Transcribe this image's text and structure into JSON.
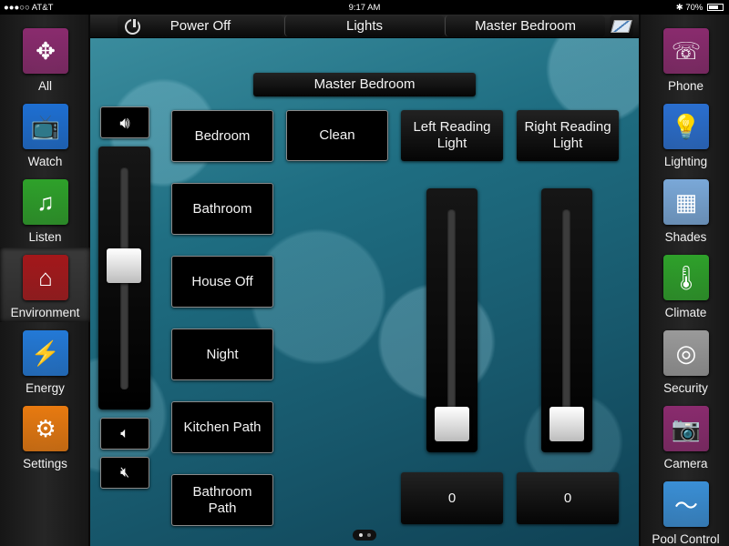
{
  "status_bar": {
    "carrier": "●●●○○ AT&T",
    "time": "9:17 AM",
    "battery": "70%",
    "battery_level": 0.7
  },
  "left_nav": [
    {
      "label": "All",
      "icon": "compass-icon",
      "glyph": "✥",
      "bg": "#8a2b6e",
      "active": false
    },
    {
      "label": "Watch",
      "icon": "tv-icon",
      "glyph": "📺",
      "bg": "#1e6fd2",
      "active": false
    },
    {
      "label": "Listen",
      "icon": "music-note-icon",
      "glyph": "♫",
      "bg": "#2ea12a",
      "active": false
    },
    {
      "label": "Environment",
      "icon": "house-icon",
      "glyph": "⌂",
      "bg": "#a3171a",
      "active": true
    },
    {
      "label": "Energy",
      "icon": "plug-icon",
      "glyph": "⚡",
      "bg": "#2379d6",
      "active": false
    },
    {
      "label": "Settings",
      "icon": "gears-icon",
      "glyph": "⚙",
      "bg": "#e87a10",
      "active": false
    }
  ],
  "right_nav": [
    {
      "label": "Phone",
      "icon": "phone-icon",
      "glyph": "☏",
      "bg": "#8a2b6e"
    },
    {
      "label": "Lighting",
      "icon": "light-bulb-icon",
      "glyph": "💡",
      "bg": "#2a6fd0"
    },
    {
      "label": "Shades",
      "icon": "window-shades-icon",
      "glyph": "▦",
      "bg": "#7aa8d8"
    },
    {
      "label": "Climate",
      "icon": "thermometer-icon",
      "glyph": "🌡",
      "bg": "#2ea12a"
    },
    {
      "label": "Security",
      "icon": "safe-dial-icon",
      "glyph": "◎",
      "bg": "#9a9a9a"
    },
    {
      "label": "Camera",
      "icon": "security-camera-icon",
      "glyph": "📷",
      "bg": "#8a2b6e"
    },
    {
      "label": "Pool Control",
      "icon": "pool-icon",
      "glyph": "〜",
      "bg": "#3a8fd6"
    }
  ],
  "top_bar": {
    "power_label": "Power Off",
    "category": "Lights",
    "room": "Master Bedroom"
  },
  "room_title": "Master Bedroom",
  "scene_buttons": [
    "Bedroom",
    "Bathroom",
    "House Off",
    "Night",
    "Kitchen Path",
    "Bathroom Path"
  ],
  "top_buttons": [
    "Clean",
    "Left Reading Light",
    "Right Reading Light"
  ],
  "volume_level": 0.56,
  "dimmers": [
    {
      "name": "Left Reading Light",
      "value": "0",
      "level": 0
    },
    {
      "name": "Right Reading Light",
      "value": "0",
      "level": 0
    }
  ],
  "page_indicator": {
    "current": 1,
    "total": 2
  }
}
